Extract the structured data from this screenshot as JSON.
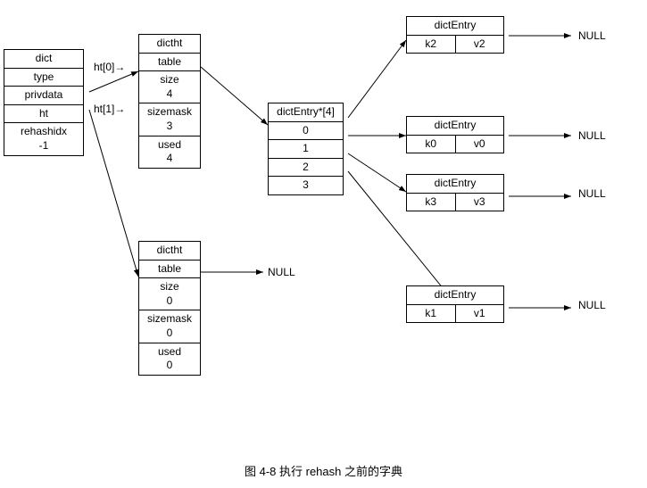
{
  "caption": "图 4-8   执行 rehash 之前的字典",
  "dict_box": {
    "title": "dict",
    "cells": [
      "type",
      "privdata",
      "ht",
      "rehashidx\n-1"
    ]
  },
  "ht_labels": {
    "ht0": "ht[0]",
    "ht1": "ht[1]"
  },
  "dictht_top": {
    "title": "dictht",
    "cells": [
      "table",
      "size\n4",
      "sizemask\n3",
      "used\n4"
    ]
  },
  "dictht_bottom": {
    "title": "dictht",
    "cells": [
      "table",
      "size\n0",
      "sizemask\n0",
      "used\n0"
    ]
  },
  "dictentry_array": {
    "title": "dictEntry*[4]",
    "cells": [
      "0",
      "1",
      "2",
      "3"
    ]
  },
  "dictentry_k2v2": {
    "k": "k2",
    "v": "v2"
  },
  "dictentry_k0v0": {
    "k": "k0",
    "v": "v0"
  },
  "dictentry_k3v3": {
    "k": "k3",
    "v": "v3"
  },
  "dictentry_k1v1": {
    "k": "k1",
    "v": "v1"
  },
  "null_labels": [
    "NULL",
    "NULL",
    "NULL",
    "NULL",
    "NULL"
  ]
}
